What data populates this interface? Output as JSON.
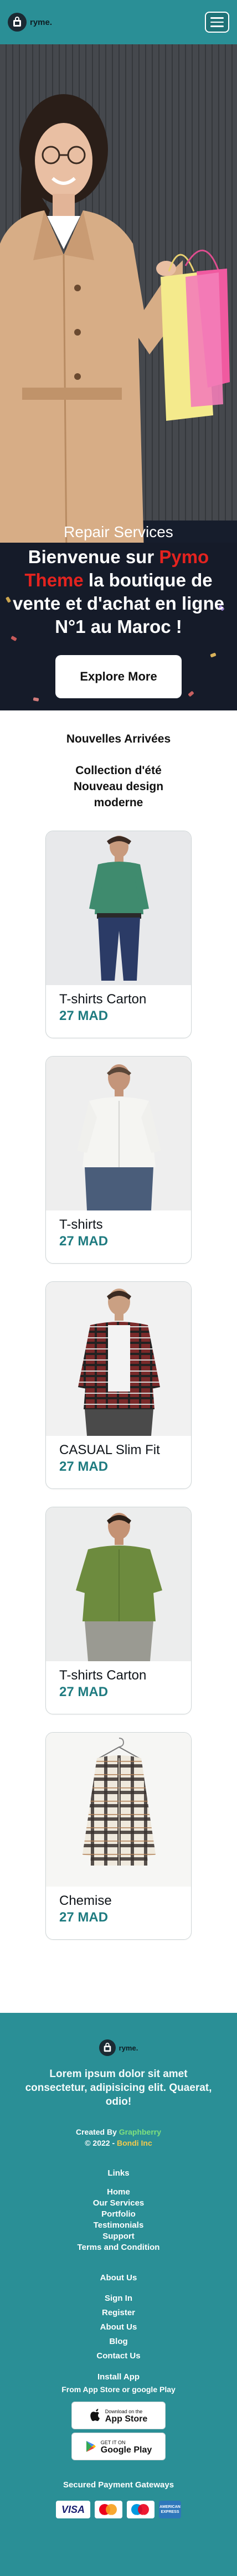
{
  "header": {
    "logo_text": "ryme."
  },
  "hero": {
    "subtitle": "Repair Services",
    "title_prefix": "Bienvenue sur ",
    "title_brand": "Pymo Theme",
    "title_suffix": " la boutique de vente et d'achat en ligne N°1 au Maroc !",
    "cta_label": "Explore More"
  },
  "section": {
    "title": "Nouvelles Arrivées",
    "collection": "Collection d'été Nouveau design moderne"
  },
  "products": [
    {
      "name": "T-shirts Carton",
      "price": "27 MAD"
    },
    {
      "name": "T-shirts",
      "price": "27 MAD"
    },
    {
      "name": "CASUAL Slim Fit",
      "price": "27 MAD"
    },
    {
      "name": "T-shirts Carton",
      "price": "27 MAD"
    },
    {
      "name": "Chemise",
      "price": "27 MAD"
    }
  ],
  "footer": {
    "logo_text": "ryme.",
    "lorem": "Lorem ipsum dolor sit amet consectetur, adipisicing elit. Quaerat, odio!",
    "created_prefix": "Created By ",
    "created_by": "Graphberry",
    "copyright_prefix": "© 2022 - ",
    "copyright_company": "Bondi Inc",
    "links_heading": "Links",
    "links": [
      "Home",
      "Our Services",
      "Portfolio",
      "Testimonials",
      "Support",
      "Terms and Condition"
    ],
    "about_heading": "About Us",
    "about_links": [
      "Sign In",
      "Register",
      "About Us",
      "Blog",
      "Contact Us"
    ],
    "install_heading": "Install App",
    "install_sub": "From App Store or google Play",
    "app_store_small": "Download on the",
    "app_store_big": "App Store",
    "google_play_small": "GET IT ON",
    "google_play_big": "Google Play",
    "payments_heading": "Secured Payment Gateways",
    "payments": [
      "VISA",
      "mastercard",
      "maestro",
      "AMERICAN EXPRESS"
    ]
  }
}
